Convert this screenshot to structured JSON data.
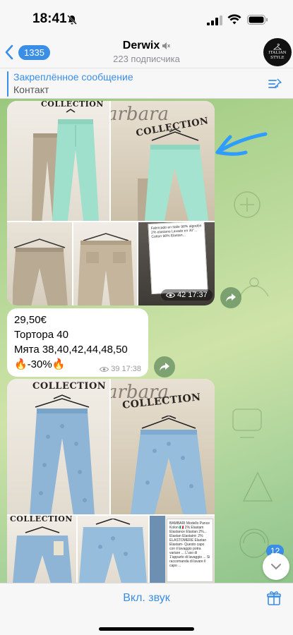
{
  "status_bar": {
    "time": "18:41",
    "icons": [
      "mute-icon",
      "signal-icon",
      "wifi-icon",
      "battery-icon"
    ]
  },
  "header": {
    "back_badge": "1335",
    "title": "Derwix",
    "subtitle": "223 подписчика",
    "avatar_text": "ITALIAN STYLE"
  },
  "pinned": {
    "title": "Закреплённое сообщение",
    "text": "Контакт"
  },
  "album1": {
    "brand_top": "COLLECTION",
    "brand_script": "arbara",
    "brand_right": "COLLECTION",
    "views": "42",
    "time": "17:37"
  },
  "text_message": {
    "lines": [
      "29,50€",
      "Тортора 40",
      "Мята 38,40,42,44,48,50",
      "🔥-30%🔥"
    ],
    "views": "39",
    "time": "17:38"
  },
  "album2": {
    "brand_top": "COLLECTION",
    "brand_script": "arbara",
    "brand_right": "COLLECTION",
    "label_text": "BAMBARI Modello Pance Kolon 🇮🇹 2% Elastam Elastance Elastan 2%... Elastan Elastaint- 2% ELASTOMERE Elastan Elastam- Questo capo con il lavaggio potra variare ... L'uso di 1'apparto di lavaggio ... Si raccomanda di lavare il capo ..."
  },
  "label_card_text": "Fabricado en Italie 98% algodón 2% elastano Lavado en 30°... Cotton 98% Elastan...",
  "unread_count": "12",
  "bottom_bar": {
    "unmute_label": "Вкл. звук"
  },
  "colors": {
    "accent": "#3a8ee6",
    "mint": "#9fe0cc",
    "taupe": "#b9ab93",
    "denim": "#8fb5d6"
  }
}
